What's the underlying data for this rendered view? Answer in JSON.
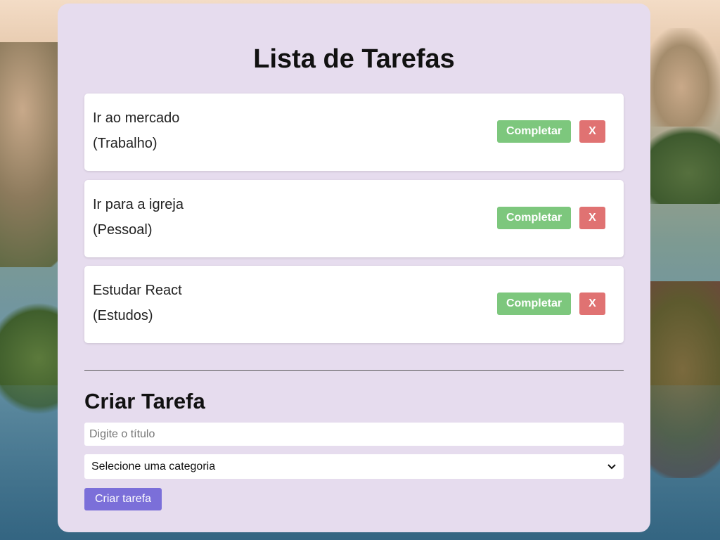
{
  "header": {
    "title": "Lista de Tarefas"
  },
  "tasks": [
    {
      "name": "Ir ao mercado",
      "category": "(Trabalho)",
      "complete_label": "Completar",
      "delete_label": "X"
    },
    {
      "name": "Ir para a igreja",
      "category": "(Pessoal)",
      "complete_label": "Completar",
      "delete_label": "X"
    },
    {
      "name": "Estudar React",
      "category": "(Estudos)",
      "complete_label": "Completar",
      "delete_label": "X"
    }
  ],
  "form": {
    "heading": "Criar Tarefa",
    "title_placeholder": "Digite o título",
    "title_value": "",
    "category_selected": "Selecione uma categoria",
    "submit_label": "Criar tarefa"
  },
  "colors": {
    "panel": "#e6dcee",
    "complete_button": "#7dc77d",
    "delete_button": "#e07272",
    "create_button": "#7b6fd9"
  },
  "icons": {
    "select_arrow": "chevron-down-icon"
  }
}
